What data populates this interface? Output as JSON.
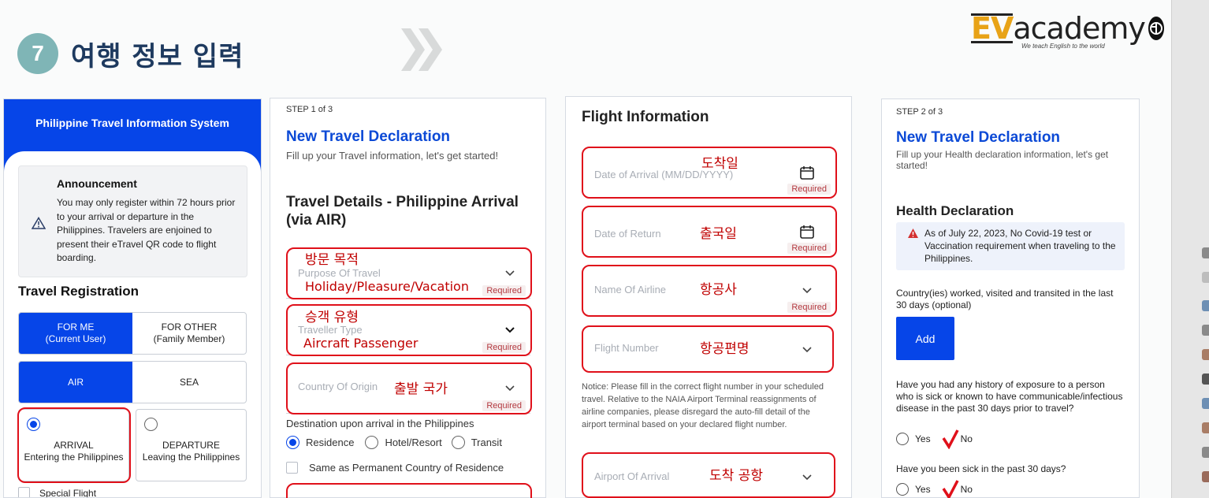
{
  "header": {
    "step_number": "7",
    "title": "여행 정보 입력",
    "logo_ev": "EV",
    "logo_rest": "academy",
    "logo_tagline": "We teach English to the world"
  },
  "panel1": {
    "system_title": "Philippine Travel Information System",
    "announcement_title": "Announcement",
    "announcement_text": "You may only register within 72 hours prior to your arrival or departure in the Philippines. Travelers are enjoined to present their eTravel QR code to flight boarding.",
    "registration_title": "Travel Registration",
    "for_me_l1": "FOR ME",
    "for_me_l2": "(Current User)",
    "for_other_l1": "FOR OTHER",
    "for_other_l2": "(Family Member)",
    "air": "AIR",
    "sea": "SEA",
    "arrival_l1": "ARRIVAL",
    "arrival_l2": "Entering the Philippines",
    "departure_l1": "DEPARTURE",
    "departure_l2": "Leaving the Philippines",
    "special_flight": "Special Flight"
  },
  "panel2": {
    "step": "STEP 1 of 3",
    "title": "New Travel Declaration",
    "subtitle": "Fill up your Travel information, let's get started!",
    "section": "Travel Details - Philippine Arrival (via AIR)",
    "purpose_annot": "방문 목적",
    "purpose_label": "Purpose Of Travel",
    "purpose_value": "Holiday/Pleasure/Vacation",
    "traveller_annot": "승객 유형",
    "traveller_label": "Traveller Type",
    "traveller_value": "Aircraft Passenger",
    "origin_label": "Country Of Origin",
    "origin_annot": "출발 국가",
    "required": "Required",
    "destination_label": "Destination upon arrival in the Philippines",
    "dest_residence": "Residence",
    "dest_hotel": "Hotel/Resort",
    "dest_transit": "Transit",
    "same_as": "Same as Permanent Country of Residence"
  },
  "panel3": {
    "title": "Flight Information",
    "arrival_annot": "도착일",
    "arrival_label": "Date of Arrival (MM/DD/YYYY)",
    "return_label": "Date of Return",
    "return_annot": "출국일",
    "airline_label": "Name Of Airline",
    "airline_annot": "항공사",
    "flight_label": "Flight Number",
    "flight_annot": "항공편명",
    "notice": "Notice: Please fill in the correct flight number in your scheduled travel. Relative to the NAIA Airport Terminal reassignments of airline companies, please disregard the auto-fill detail of the airport terminal based on your declared flight number.",
    "airport_label": "Airport Of Arrival",
    "airport_annot": "도착 공항",
    "required": "Required"
  },
  "panel4": {
    "step": "STEP 2 of 3",
    "title": "New Travel Declaration",
    "subtitle": "Fill up your Health declaration information, let's get started!",
    "section": "Health Declaration",
    "note": "As of July 22, 2023, No Covid-19 test or Vaccination requirement when traveling to the Philippines.",
    "countries_q": "Country(ies) worked, visited and transited in the last 30 days (optional)",
    "add": "Add",
    "exposure_q": "Have you had any history of exposure to a person who is sick or known to have communicable/infectious disease in the past 30 days prior to travel?",
    "sick_q": "Have you been sick in the past 30 days?",
    "yes": "Yes",
    "no": "No"
  },
  "colors": {
    "brand_blue": "#0645e8",
    "link_blue": "#0b49d6",
    "annotation_red": "#e0101a",
    "badge_teal": "#7fb5b6"
  }
}
